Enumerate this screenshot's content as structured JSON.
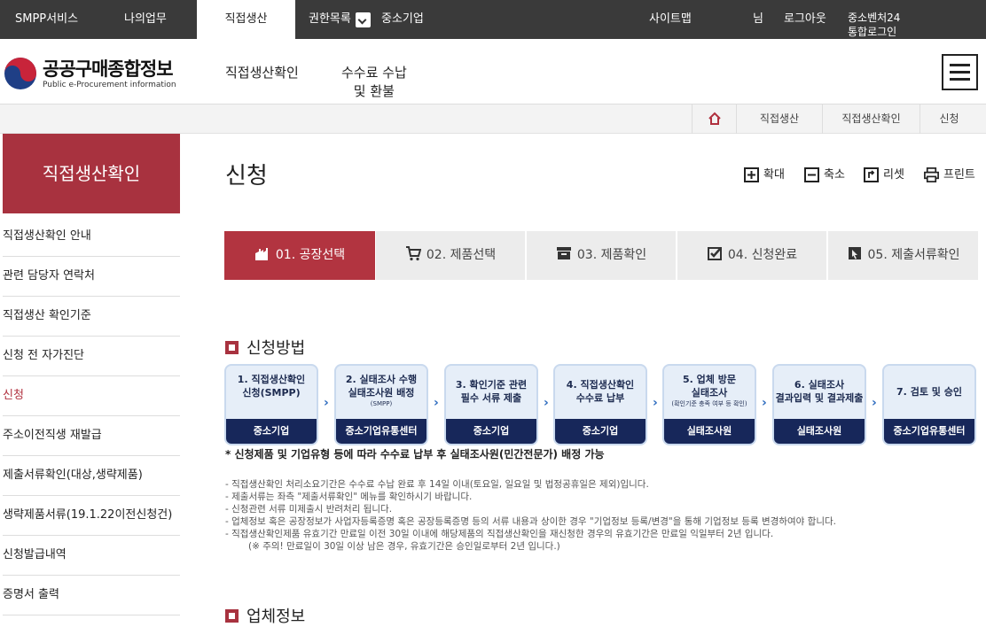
{
  "topbar": {
    "smpp": "SMPP서비스",
    "mywork": "나의업무",
    "direct": "직접생산",
    "authlist": "권한목록",
    "sme": "중소기업",
    "sitemap": "사이트맵",
    "user_suffix": "님",
    "logout": "로그아웃",
    "venture_line1": "중소벤처24",
    "venture_line2": "통합로그인"
  },
  "header": {
    "logo_title": "공공구매종합정보",
    "logo_sub": "Public e-Procurement information",
    "nav": [
      {
        "label": "직접생산확인"
      },
      {
        "label1": "수수료 수납",
        "label2": "및 환불"
      }
    ]
  },
  "breadcrumb": [
    "직접생산",
    "직접생산확인",
    "신청"
  ],
  "sidebar": {
    "title": "직접생산확인",
    "items": [
      "직접생산확인 안내",
      "관련 담당자 연락처",
      "직접생산 확인기준",
      "신청 전 자가진단",
      "신청",
      "주소이전직생 재발급",
      "제출서류확인(대상,생략제품)",
      "생략제품서류(19.1.22이전신청건)",
      "신청발급내역",
      "증명서 출력"
    ],
    "active_index": 4
  },
  "main": {
    "title": "신청",
    "tools": {
      "zoom_in": "확대",
      "zoom_out": "축소",
      "reset": "리셋",
      "print": "프린트"
    },
    "steps": [
      "01. 공장선택",
      "02. 제품선택",
      "03. 제품확인",
      "04. 신청완료",
      "05. 제출서류확인"
    ],
    "active_step": 0,
    "section1": "신청방법",
    "section2": "업체정보",
    "flow": [
      {
        "line1": "1. 직접생산확인",
        "line2": "신청(SMPP)",
        "small": "",
        "who": "중소기업"
      },
      {
        "line1": "2. 실태조사 수행",
        "line2": "실태조사원 배정",
        "small": "(SMPP)",
        "who": "중소기업유통센터"
      },
      {
        "line1": "3. 확인기준 관련",
        "line2": "필수 서류 제출",
        "small": "",
        "who": "중소기업"
      },
      {
        "line1": "4. 직접생산확인",
        "line2": "수수료 납부",
        "small": "",
        "who": "중소기업"
      },
      {
        "line1": "5. 업체 방문",
        "line2": "실태조사",
        "small": "(확인기준 충족 여부 등 확인)",
        "who": "실태조사원"
      },
      {
        "line1": "6. 실태조사",
        "line2": "결과입력 및 결과제출",
        "small": "",
        "who": "실태조사원"
      },
      {
        "line1": "7. 검토 및 승인",
        "line2": "",
        "small": "",
        "who": "중소기업유통센터"
      }
    ],
    "star_note": "* 신청제품 및 기업유형 등에 따라 수수료 납부 후 실태조사원(민간전문가) 배정 가능",
    "notes": [
      "- 직접생산확인 처리소요기간은 수수료 수납 완료 후 14일 이내(토요일, 일요일 및 법정공휴일은 제외)입니다.",
      "- 제출서류는 좌측 \"제출서류확인\" 메뉴를 확인하시기 바랍니다.",
      "- 신청관련 서류 미제출시 반려처리 됩니다.",
      "- 업체정보 혹은 공장정보가 사업자등록증명 혹은 공장등록증명 등의 서류 내용과 상이한 경우 \"기업정보 등록/변경\"을 통해 기업정보 등록 변경하여야 합니다.",
      "- 직접생산확인제품 유효기간 만료일 이전 30일 이내에 해당제품의 직접생산확인을 재신청한 경우의 유효기간은 만료일 익일부터 2년 입니다.",
      "(※ 주의! 만료일이 30일 이상 남은 경우, 유효기간은 승인일로부터 2년 입니다.)"
    ]
  }
}
